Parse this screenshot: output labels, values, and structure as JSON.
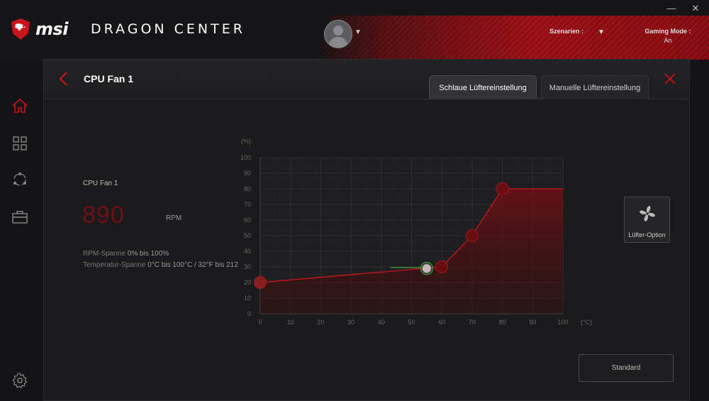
{
  "app": {
    "brand": "msi",
    "title": "DRAGON CENTER",
    "window_controls": {
      "minimize": "—",
      "close": "✕"
    }
  },
  "header": {
    "scenarios_label": "Szenarien :",
    "gaming_mode_label": "Gaming Mode :",
    "gaming_mode_value": "An"
  },
  "sidebar": {
    "items": [
      "home-icon",
      "apps-grid-icon",
      "network-icon",
      "toolbox-icon"
    ],
    "bottom": "gear-icon"
  },
  "panel": {
    "title": "CPU Fan 1",
    "tabs": [
      {
        "label": "Schlaue Lüftereinstellung",
        "active": true
      },
      {
        "label": "Manuelle Lüftereinstellung",
        "active": false
      }
    ],
    "fan_name": "CPU Fan 1",
    "rpm_value": "890",
    "rpm_unit": "RPM",
    "rpm_range_label": "RPM-Spanne",
    "rpm_range_value": "0% bis 100%",
    "temp_range_label": "Temperatur-Spanne",
    "temp_range_value": "0°C bis 100°C / 32°F bis 212",
    "fan_option_label": "Lüfter-Option",
    "standard_button": "Standard"
  },
  "colors": {
    "accent_red": "#c8141c",
    "dark_red": "#6e1014",
    "curve_point": "#7a0e12"
  },
  "chart_data": {
    "type": "line",
    "y_unit": "(%)",
    "x_unit": "(°C)",
    "xlim": [
      0,
      100
    ],
    "ylim": [
      0,
      100
    ],
    "x_ticks": [
      0,
      10,
      20,
      30,
      40,
      50,
      60,
      70,
      80,
      90,
      100
    ],
    "y_ticks": [
      0,
      10,
      20,
      30,
      40,
      50,
      60,
      70,
      80,
      90,
      100
    ],
    "curve_points": [
      {
        "x": 0,
        "y": 20
      },
      {
        "x": 60,
        "y": 30
      },
      {
        "x": 70,
        "y": 50
      },
      {
        "x": 80,
        "y": 80
      }
    ],
    "curve_end_x": 100,
    "current_point": {
      "x": 55,
      "y": 29
    },
    "green_segment": {
      "x": [
        43,
        55
      ],
      "y": [
        29.5,
        29.5
      ]
    },
    "grid": true
  }
}
